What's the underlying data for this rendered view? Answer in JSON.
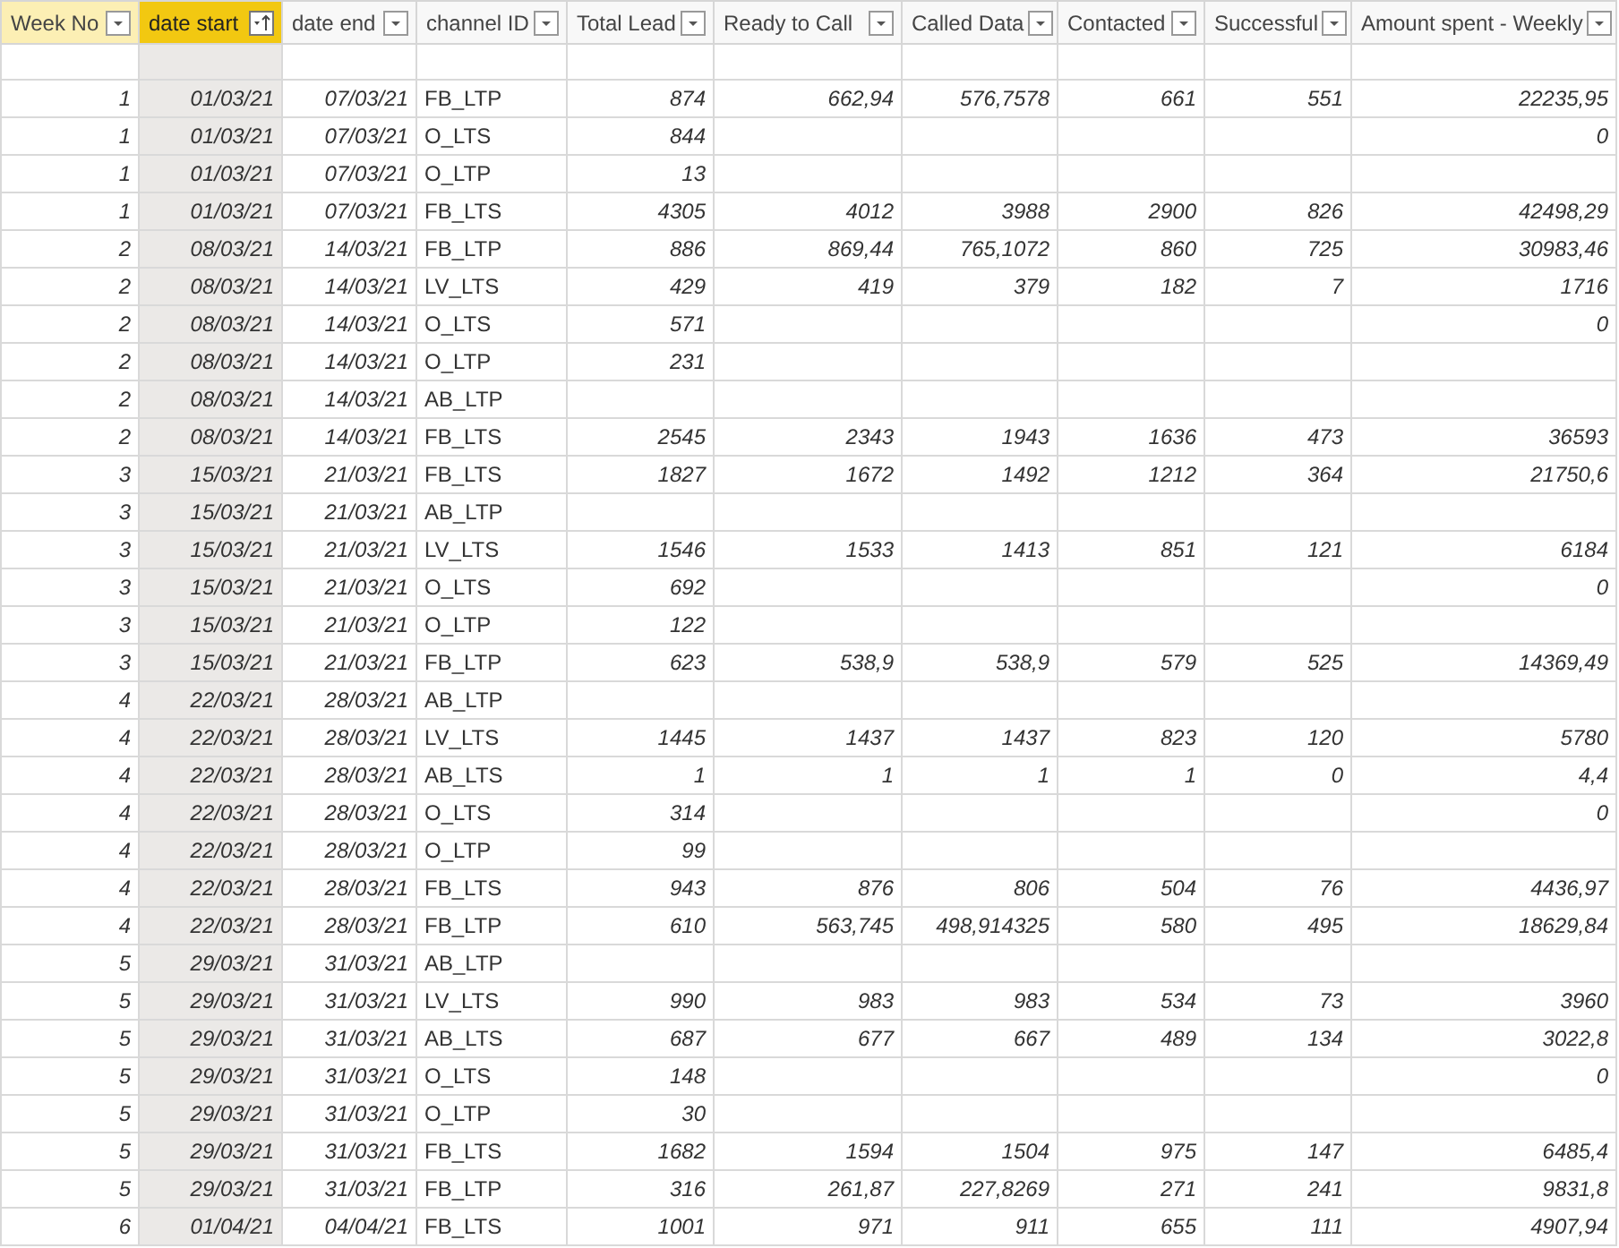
{
  "table": {
    "columns": [
      {
        "label": "Week No",
        "kind": "number",
        "hovered": true,
        "selected": false,
        "sorted": false
      },
      {
        "label": "date start",
        "kind": "number",
        "hovered": false,
        "selected": true,
        "sorted": true
      },
      {
        "label": "date end",
        "kind": "number",
        "hovered": false,
        "selected": false,
        "sorted": false
      },
      {
        "label": "channel ID",
        "kind": "text",
        "hovered": false,
        "selected": false,
        "sorted": false
      },
      {
        "label": "Total Lead",
        "kind": "number",
        "hovered": false,
        "selected": false,
        "sorted": false
      },
      {
        "label": "Ready to Call",
        "kind": "number",
        "hovered": false,
        "selected": false,
        "sorted": false
      },
      {
        "label": "Called Data",
        "kind": "number",
        "hovered": false,
        "selected": false,
        "sorted": false
      },
      {
        "label": "Contacted",
        "kind": "number",
        "hovered": false,
        "selected": false,
        "sorted": false
      },
      {
        "label": "Successful",
        "kind": "number",
        "hovered": false,
        "selected": false,
        "sorted": false
      },
      {
        "label": "Amount spent - Weekly",
        "kind": "number",
        "hovered": false,
        "selected": false,
        "sorted": false
      }
    ],
    "rows": [
      [
        "1",
        "01/03/21",
        "07/03/21",
        "FB_LTP",
        "874",
        "662,94",
        "576,7578",
        "661",
        "551",
        "22235,95"
      ],
      [
        "1",
        "01/03/21",
        "07/03/21",
        "O_LTS",
        "844",
        null,
        null,
        null,
        null,
        "0"
      ],
      [
        "1",
        "01/03/21",
        "07/03/21",
        "O_LTP",
        "13",
        null,
        null,
        null,
        null,
        null
      ],
      [
        "1",
        "01/03/21",
        "07/03/21",
        "FB_LTS",
        "4305",
        "4012",
        "3988",
        "2900",
        "826",
        "42498,29"
      ],
      [
        "2",
        "08/03/21",
        "14/03/21",
        "FB_LTP",
        "886",
        "869,44",
        "765,1072",
        "860",
        "725",
        "30983,46"
      ],
      [
        "2",
        "08/03/21",
        "14/03/21",
        "LV_LTS",
        "429",
        "419",
        "379",
        "182",
        "7",
        "1716"
      ],
      [
        "2",
        "08/03/21",
        "14/03/21",
        "O_LTS",
        "571",
        null,
        null,
        null,
        null,
        "0"
      ],
      [
        "2",
        "08/03/21",
        "14/03/21",
        "O_LTP",
        "231",
        null,
        null,
        null,
        null,
        null
      ],
      [
        "2",
        "08/03/21",
        "14/03/21",
        "AB_LTP",
        null,
        null,
        null,
        null,
        null,
        null
      ],
      [
        "2",
        "08/03/21",
        "14/03/21",
        "FB_LTS",
        "2545",
        "2343",
        "1943",
        "1636",
        "473",
        "36593"
      ],
      [
        "3",
        "15/03/21",
        "21/03/21",
        "FB_LTS",
        "1827",
        "1672",
        "1492",
        "1212",
        "364",
        "21750,6"
      ],
      [
        "3",
        "15/03/21",
        "21/03/21",
        "AB_LTP",
        null,
        null,
        null,
        null,
        null,
        null
      ],
      [
        "3",
        "15/03/21",
        "21/03/21",
        "LV_LTS",
        "1546",
        "1533",
        "1413",
        "851",
        "121",
        "6184"
      ],
      [
        "3",
        "15/03/21",
        "21/03/21",
        "O_LTS",
        "692",
        null,
        null,
        null,
        null,
        "0"
      ],
      [
        "3",
        "15/03/21",
        "21/03/21",
        "O_LTP",
        "122",
        null,
        null,
        null,
        null,
        null
      ],
      [
        "3",
        "15/03/21",
        "21/03/21",
        "FB_LTP",
        "623",
        "538,9",
        "538,9",
        "579",
        "525",
        "14369,49"
      ],
      [
        "4",
        "22/03/21",
        "28/03/21",
        "AB_LTP",
        null,
        null,
        null,
        null,
        null,
        null
      ],
      [
        "4",
        "22/03/21",
        "28/03/21",
        "LV_LTS",
        "1445",
        "1437",
        "1437",
        "823",
        "120",
        "5780"
      ],
      [
        "4",
        "22/03/21",
        "28/03/21",
        "AB_LTS",
        "1",
        "1",
        "1",
        "1",
        "0",
        "4,4"
      ],
      [
        "4",
        "22/03/21",
        "28/03/21",
        "O_LTS",
        "314",
        null,
        null,
        null,
        null,
        "0"
      ],
      [
        "4",
        "22/03/21",
        "28/03/21",
        "O_LTP",
        "99",
        null,
        null,
        null,
        null,
        null
      ],
      [
        "4",
        "22/03/21",
        "28/03/21",
        "FB_LTS",
        "943",
        "876",
        "806",
        "504",
        "76",
        "4436,97"
      ],
      [
        "4",
        "22/03/21",
        "28/03/21",
        "FB_LTP",
        "610",
        "563,745",
        "498,914325",
        "580",
        "495",
        "18629,84"
      ],
      [
        "5",
        "29/03/21",
        "31/03/21",
        "AB_LTP",
        null,
        null,
        null,
        null,
        null,
        null
      ],
      [
        "5",
        "29/03/21",
        "31/03/21",
        "LV_LTS",
        "990",
        "983",
        "983",
        "534",
        "73",
        "3960"
      ],
      [
        "5",
        "29/03/21",
        "31/03/21",
        "AB_LTS",
        "687",
        "677",
        "667",
        "489",
        "134",
        "3022,8"
      ],
      [
        "5",
        "29/03/21",
        "31/03/21",
        "O_LTS",
        "148",
        null,
        null,
        null,
        null,
        "0"
      ],
      [
        "5",
        "29/03/21",
        "31/03/21",
        "O_LTP",
        "30",
        null,
        null,
        null,
        null,
        null
      ],
      [
        "5",
        "29/03/21",
        "31/03/21",
        "FB_LTS",
        "1682",
        "1594",
        "1504",
        "975",
        "147",
        "6485,4"
      ],
      [
        "5",
        "29/03/21",
        "31/03/21",
        "FB_LTP",
        "316",
        "261,87",
        "227,8269",
        "271",
        "241",
        "9831,8"
      ],
      [
        "6",
        "01/04/21",
        "04/04/21",
        "FB_LTS",
        "1001",
        "971",
        "911",
        "655",
        "111",
        "4907,94"
      ]
    ]
  }
}
